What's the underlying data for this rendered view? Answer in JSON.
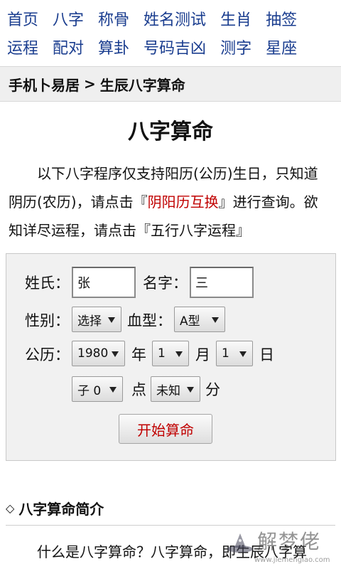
{
  "nav": {
    "row1": [
      "首页",
      "八字",
      "称骨",
      "姓名测试",
      "生肖",
      "抽签"
    ],
    "row2": [
      "运程",
      "配对",
      "算卦",
      "号码吉凶",
      "测字",
      "星座"
    ]
  },
  "breadcrumb": {
    "home": "手机卜易居",
    "separator": ">",
    "current": "生辰八字算命"
  },
  "page_title": "八字算命",
  "intro": {
    "line1": "以下八字程序仅支持阳历(公历)生日，只知道",
    "line2_pre": "阴历(农历)，请点击『",
    "line2_link": "阴阳历互换",
    "line2_post": "』进行查询。欲",
    "line3": "知详尽运程，请点击『五行八字运程』"
  },
  "form": {
    "surname_label": "姓氏：",
    "surname_value": "张",
    "name_label": "名字：",
    "name_value": "三",
    "gender_label": "性别：",
    "gender_value": "选择",
    "blood_label": "血型：",
    "blood_value": "A型",
    "calendar_label": "公历：",
    "year_value": "1980",
    "year_unit": "年",
    "month_value": "1",
    "month_unit": "月",
    "day_value": "1",
    "day_unit": "日",
    "hour_value": "子 0",
    "hour_unit": "点",
    "minute_value": "未知",
    "minute_unit": "分",
    "submit_label": "开始算命"
  },
  "section": {
    "icon": "diamond-icon",
    "title": "八字算命简介"
  },
  "bottom_text": "什么是八字算命？八字算命，即生辰八字算",
  "watermark": {
    "text": "解梦佬",
    "url": "www.jiemenglao.com"
  },
  "colors": {
    "nav_link": "#1a3d8f",
    "highlight": "#c00000",
    "crumb_bg": "#efefef",
    "form_bg": "#f1f1f1"
  }
}
